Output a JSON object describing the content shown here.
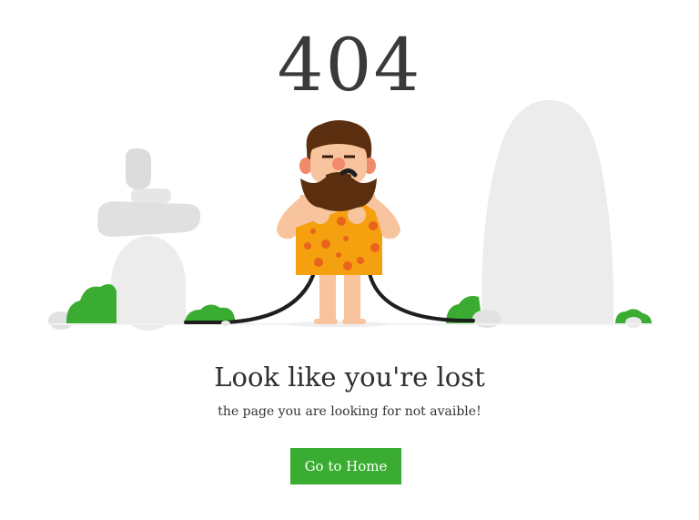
{
  "error_code": "404",
  "headline": "Look like you're lost",
  "subtext": "the page you are looking for not avaible!",
  "home_button_label": "Go to Home",
  "colors": {
    "accent_green": "#39ac31",
    "rock_gray": "#ececec",
    "bush_green": "#39ac31",
    "cloth_orange": "#f5a00f",
    "cloth_spots": "#e9631c",
    "skin": "#f7c49e",
    "hair": "#5b2e10",
    "cable": "#1e1e1e",
    "text_dark": "#333333"
  }
}
